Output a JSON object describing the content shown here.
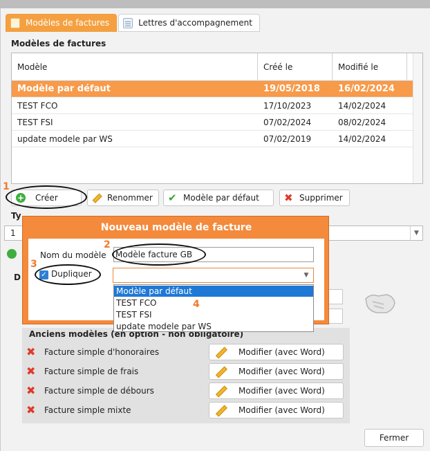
{
  "tabs": [
    {
      "label": "Modèles de factures",
      "active": true
    },
    {
      "label": "Lettres d'accompagnement",
      "active": false
    }
  ],
  "section_title": "Modèles de factures",
  "grid": {
    "columns": [
      "Modèle",
      "Créé le",
      "Modifié le"
    ],
    "rows": [
      {
        "model": "Modèle par défaut",
        "created": "19/05/2018",
        "modified": "16/02/2024",
        "selected": true
      },
      {
        "model": "TEST FCO",
        "created": "17/10/2023",
        "modified": "14/02/2024",
        "selected": false
      },
      {
        "model": "TEST FSI",
        "created": "07/02/2024",
        "modified": "08/02/2024",
        "selected": false
      },
      {
        "model": "update modele par WS",
        "created": "07/02/2019",
        "modified": "14/02/2024",
        "selected": false
      }
    ]
  },
  "toolbar": {
    "create": "Créer",
    "rename": "Renommer",
    "default": "Modèle par défaut",
    "delete": "Supprimer"
  },
  "annotations": {
    "n1": "1",
    "n2": "2",
    "n3": "3",
    "n4": "4"
  },
  "partial": {
    "type_label": "Ty",
    "combo_value": "1",
    "d_label": "D"
  },
  "modal": {
    "title": "Nouveau modèle de facture",
    "name_label": "Nom du modèle",
    "name_value": "Modèle facture GB",
    "duplicate_label": "Dupliquer",
    "duplicate_checked": true,
    "options": [
      "Modèle par défaut",
      "TEST FCO",
      "TEST FSI",
      "update modele par WS"
    ],
    "highlighted_option": 0
  },
  "anciens": {
    "title": "Anciens modèles (en option - non obligatoire)",
    "items": [
      "Facture simple d'honoraires",
      "Facture simple de frais",
      "Facture simple de débours",
      "Facture simple mixte"
    ],
    "button_label": "Modifier (avec Word)"
  },
  "close_button": "Fermer",
  "colors": {
    "accent": "#f5a040",
    "selection": "#1f78d6",
    "modal": "#f48a3c"
  }
}
